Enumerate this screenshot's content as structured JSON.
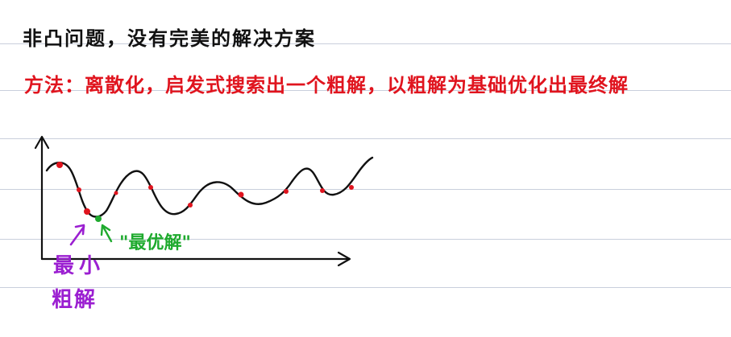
{
  "notes": {
    "title": "非凸问题，没有完美的解决方案",
    "method": "方法：离散化，启发式搜索出一个粗解，以粗解为基础优化出最终解"
  },
  "annotations": {
    "min_rough_solution_line1": "最小",
    "min_rough_solution_line2": "粗解",
    "optimal_solution": "\"最优解\""
  },
  "colors": {
    "ink": "#111111",
    "red": "#e0141e",
    "purple": "#9b1fd1",
    "green": "#1faa2e",
    "rule": "#c9cfdc"
  },
  "icons": {
    "axes": "axis-arrows",
    "purple_pointer": "arrow-up-right-icon",
    "green_pointer": "arrow-up-left-icon"
  }
}
